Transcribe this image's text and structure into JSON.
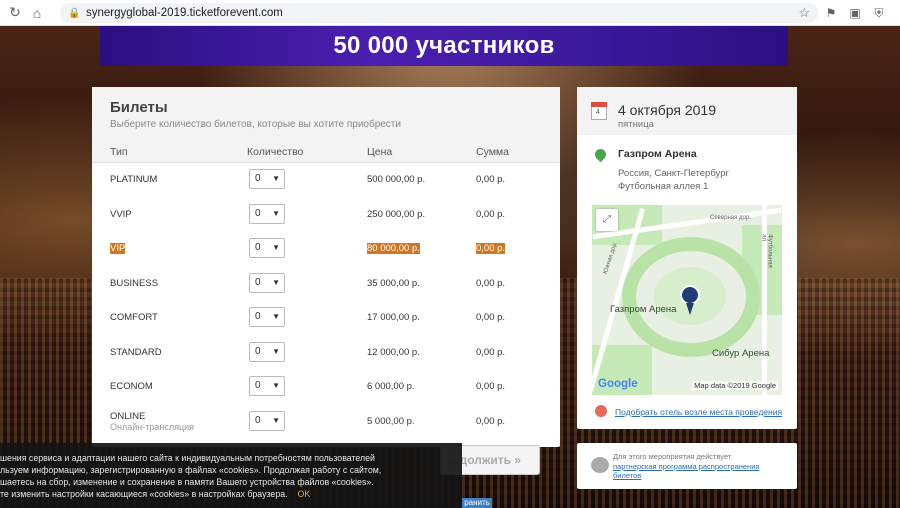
{
  "browser": {
    "url": "synergyglobal-2019.ticketforevent.com",
    "icons": [
      "reload-icon",
      "home-icon",
      "lock-icon",
      "star-icon"
    ]
  },
  "banner": {
    "text": "50 000 участников"
  },
  "tickets": {
    "title": "Билеты",
    "subtitle": "Выберите количество билетов, которые вы хотите приобрести",
    "columns": {
      "type": "Тип",
      "qty": "Количество",
      "price": "Цена",
      "sum": "Сумма"
    },
    "rows": [
      {
        "name": "PLATINUM",
        "qty": "0",
        "price": "500 000,00 р.",
        "sum": "0,00 р."
      },
      {
        "name": "VVIP",
        "qty": "0",
        "price": "250 000,00 р.",
        "sum": "0,00 р."
      },
      {
        "name": "VIP",
        "qty": "0",
        "price": "80 000,00 р.",
        "sum": "0,00 р."
      },
      {
        "name": "BUSINESS",
        "qty": "0",
        "price": "35 000,00 р.",
        "sum": "0,00 р."
      },
      {
        "name": "COMFORT",
        "qty": "0",
        "price": "17 000,00 р.",
        "sum": "0,00 р."
      },
      {
        "name": "STANDARD",
        "qty": "0",
        "price": "12 000,00 р.",
        "sum": "0,00 р."
      },
      {
        "name": "ECONOM",
        "qty": "0",
        "price": "6 000,00 р.",
        "sum": "0,00 р."
      },
      {
        "name": "ONLINE",
        "name2": "Онлайн-трансляция",
        "qty": "0",
        "price": "5 000,00 р.",
        "sum": "0,00 р."
      }
    ],
    "continue_label": "...должить »"
  },
  "event": {
    "cal_day": "4",
    "date": "4 октября 2019",
    "dow": "пятница",
    "venue": "Газпром Арена",
    "addr1": "Россия, Санкт-Петербург",
    "addr2": "Футбольная аллея 1",
    "map": {
      "label_main": "Газпром Арена",
      "label_sibur": "Сибур Арена",
      "street1": "Северная дор.",
      "street2": "Южная дор.",
      "street3": "Футбольная ал.",
      "google": "Google",
      "map_data": "Map data ©2019 Google"
    },
    "hotel_link": "Подобрать отель возле места проведения"
  },
  "partner": {
    "line1": "Для этого мероприятия действует",
    "line2": "партнерская программа распространения билетов"
  },
  "cookie": {
    "line1": "шения сервиса и адаптации нашего сайта к индивидуальным потребностям пользователей",
    "line2": "льзуем информацию, зарегистрированную в файлах «cookies». Продолжая работу с сайтом,",
    "line3": "шаетесь на сбор, изменение и сохранение в памяти Вашего устройства файлов «cookies».",
    "line4": "те изменить настройки касающиеся «cookies» в настройках браузера.",
    "ok": "OK",
    "save": "ранить"
  }
}
